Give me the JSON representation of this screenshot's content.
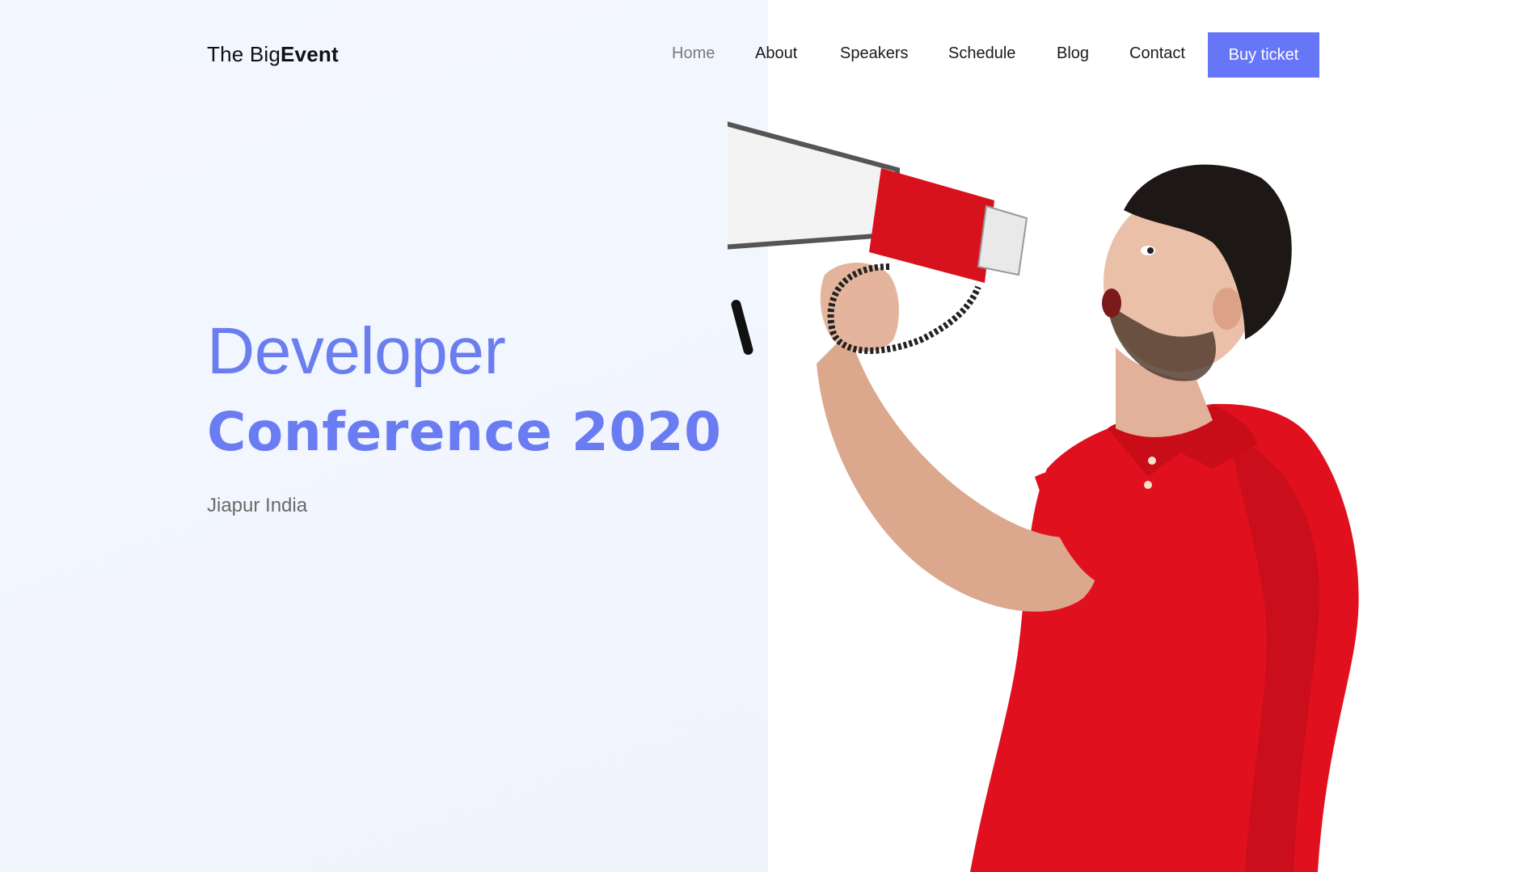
{
  "header": {
    "logo_regular": "The Big",
    "logo_bold": "Event",
    "nav": [
      {
        "label": "Home",
        "active": true
      },
      {
        "label": "About",
        "active": false
      },
      {
        "label": "Speakers",
        "active": false
      },
      {
        "label": "Schedule",
        "active": false
      },
      {
        "label": "Blog",
        "active": false
      },
      {
        "label": "Contact",
        "active": false
      }
    ],
    "cta_label": "Buy ticket"
  },
  "hero": {
    "line1": "Developer",
    "line2": "Conference 2020",
    "location": "Jiapur India"
  },
  "colors": {
    "accent": "#6776f6",
    "headline": "#6b7ef0",
    "left_bg": "#f3f7ff",
    "shirt": "#e0101e",
    "megaphone_band": "#d8121d"
  },
  "image": {
    "subject": "man shouting into megaphone"
  }
}
